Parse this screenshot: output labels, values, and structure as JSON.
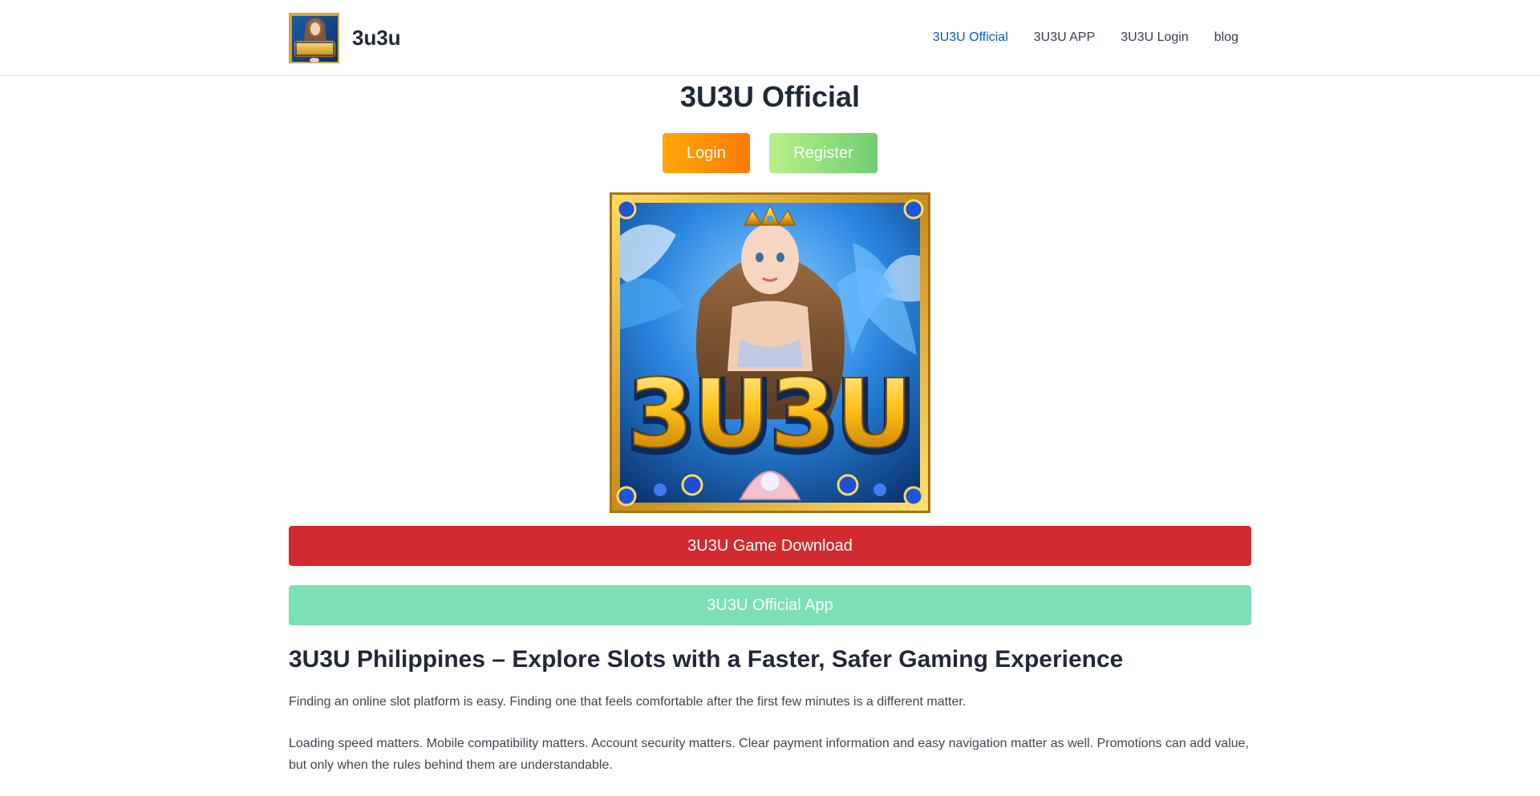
{
  "header": {
    "brand": "3u3u",
    "nav": [
      {
        "label": "3U3U Official",
        "active": true
      },
      {
        "label": "3U3U APP",
        "active": false
      },
      {
        "label": "3U3U Login",
        "active": false
      },
      {
        "label": "blog",
        "active": false
      }
    ]
  },
  "main": {
    "title": "3U3U Official",
    "login_label": "Login",
    "register_label": "Register",
    "hero_logo_text": "3U3U",
    "download_label": "3U3U Game Download",
    "app_label": "3U3U Official App",
    "heading": "3U3U Philippines – Explore Slots with a Faster, Safer Gaming Experience",
    "paragraphs": [
      "Finding an online slot platform is easy. Finding one that feels comfortable after the first few minutes is a different matter.",
      "Loading speed matters. Mobile compatibility matters. Account security matters. Clear payment information and easy navigation matter as well. Promotions can add value, but only when the rules behind them are understandable."
    ]
  },
  "colors": {
    "nav_active": "#0b5cad",
    "login_start": "#ffa70a",
    "login_end": "#ff7a00",
    "register_start": "#b8f08a",
    "register_end": "#6fce70",
    "download_bg": "#d12b2f",
    "app_bg": "#7ddfb5"
  }
}
